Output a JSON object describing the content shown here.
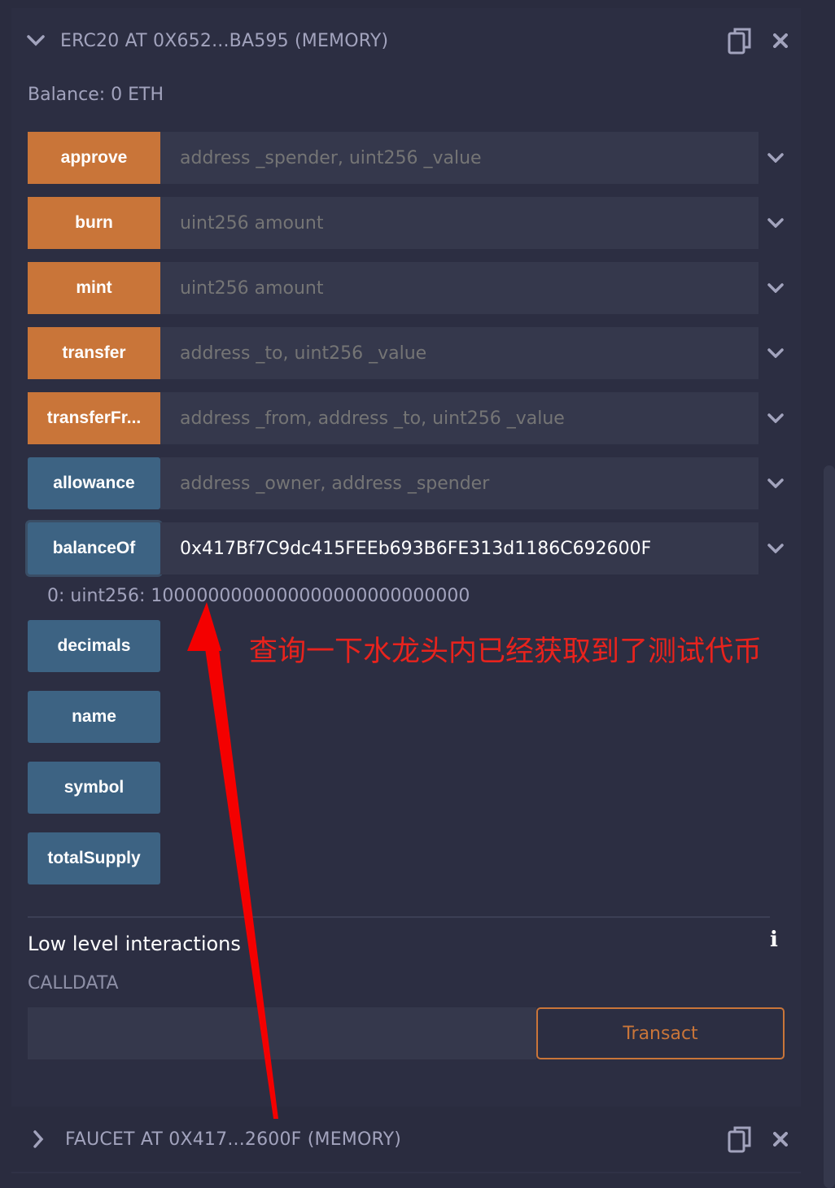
{
  "erc20_instance": {
    "title": "ERC20 AT 0X652...BA595 (MEMORY)",
    "balance": "Balance: 0 ETH",
    "functions": [
      {
        "label": "approve",
        "kind": "write",
        "placeholder": "address _spender, uint256 _value",
        "value": ""
      },
      {
        "label": "burn",
        "kind": "write",
        "placeholder": "uint256 amount",
        "value": ""
      },
      {
        "label": "mint",
        "kind": "write",
        "placeholder": "uint256 amount",
        "value": ""
      },
      {
        "label": "transfer",
        "kind": "write",
        "placeholder": "address _to, uint256 _value",
        "value": ""
      },
      {
        "label": "transferFr...",
        "kind": "write",
        "placeholder": "address _from, address _to, uint256 _value",
        "value": ""
      },
      {
        "label": "allowance",
        "kind": "read",
        "placeholder": "address _owner, address _spender",
        "value": ""
      },
      {
        "label": "balanceOf",
        "kind": "read",
        "placeholder": "",
        "value": "0x417Bf7C9dc415FEEb693B6FE313d1186C692600F"
      }
    ],
    "balanceOf_result": "0: uint256: 1000000000000000000000000000",
    "getters": [
      "decimals",
      "name",
      "symbol",
      "totalSupply"
    ]
  },
  "low_level": {
    "title": "Low level interactions",
    "calldata_label": "CALLDATA",
    "calldata_value": "",
    "transact_label": "Transact"
  },
  "faucet_instance": {
    "title": "FAUCET AT 0X417...2600F (MEMORY)"
  },
  "annotation": {
    "text": "查询一下水龙头内已经获取到了测试代币",
    "color": "#e8231d"
  },
  "colors": {
    "write_button": "#c97539",
    "read_button": "#3d6383",
    "panel_bg": "#2c2e42",
    "input_bg": "#35384c"
  }
}
